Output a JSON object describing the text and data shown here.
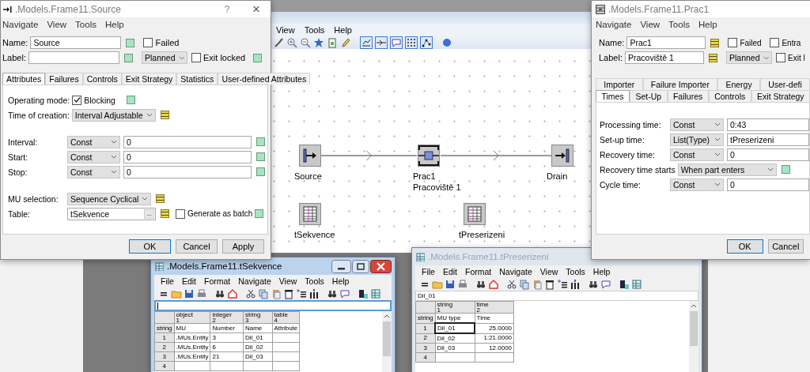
{
  "app_window": {
    "menu": [
      "View",
      "Tools",
      "Help"
    ],
    "nodes": [
      {
        "kind": "source",
        "label": "Source"
      },
      {
        "kind": "station",
        "label": "Prac1",
        "sublabel": "Pracoviště 1"
      },
      {
        "kind": "drain",
        "label": "Drain"
      },
      {
        "kind": "table",
        "label": "tSekvence"
      },
      {
        "kind": "table",
        "label": "tPreserizeni"
      }
    ]
  },
  "source_dialog": {
    "title": ".Models.Frame11.Source",
    "help": "?",
    "close": "×",
    "menu": [
      "Navigate",
      "View",
      "Tools",
      "Help"
    ],
    "header_rows": [
      {
        "label": "Name:",
        "value": "Source",
        "inherited": true,
        "extras": [
          {
            "kind": "checkbox",
            "label": "Failed",
            "checked": false
          }
        ]
      },
      {
        "label": "Label:",
        "inherited": true,
        "extras": [
          {
            "kind": "select",
            "value": "Planned"
          },
          {
            "kind": "checkbox",
            "label": "Exit locked",
            "checked": false
          },
          {
            "kind": "indicator",
            "inherited": true
          }
        ]
      }
    ],
    "tab_rows": [
      [
        {
          "label": "Attributes",
          "selected": true
        },
        {
          "label": "Failures",
          "selected": false
        },
        {
          "label": "Controls",
          "selected": false
        },
        {
          "label": "Exit Strategy",
          "selected": false
        },
        {
          "label": "Statistics",
          "selected": false
        },
        {
          "label": "User-defined Attributes",
          "selected": false
        }
      ]
    ],
    "groups": [
      [
        {
          "kind": "checkbox",
          "label": "Operating mode:",
          "text": "Blocking",
          "checked": true,
          "inherited": true
        },
        {
          "kind": "select",
          "label": "Time of creation:",
          "value": "Interval Adjustable",
          "inherited": false
        }
      ],
      [
        {
          "kind": "distribution",
          "label": "Interval:",
          "type": "Const",
          "value": "0",
          "inherited": true
        },
        {
          "kind": "distribution",
          "label": "Start:",
          "type": "Const",
          "value": "0",
          "inherited": true
        },
        {
          "kind": "distribution",
          "label": "Stop:",
          "type": "Const",
          "value": "0",
          "inherited": true
        }
      ],
      [
        {
          "kind": "select",
          "label": "MU selection:",
          "value": "Sequence Cyclical",
          "inherited": false
        },
        {
          "kind": "table",
          "label": "Table:",
          "value": "tSekvence",
          "browse": "...",
          "inherited": false,
          "extra": {
            "label": "Generate as batch",
            "checked": false,
            "inherited": true
          }
        }
      ]
    ],
    "buttons": [
      {
        "label": "OK",
        "default": true
      },
      {
        "label": "Cancel",
        "default": false
      },
      {
        "label": "Apply",
        "default": false
      }
    ]
  },
  "station_dialog": {
    "title": ".Models.Frame11.Prac1",
    "menu": [
      "Navigate",
      "View",
      "Tools",
      "Help"
    ],
    "header_rows": [
      {
        "label": "Name:",
        "value": "Prac1",
        "inherited": false,
        "extras": [
          {
            "kind": "checkbox",
            "label": "Failed",
            "checked": false
          },
          {
            "kind": "checkbox",
            "label": "Entra",
            "checked": false
          }
        ]
      },
      {
        "label": "Label:",
        "value": "Pracoviště 1",
        "inherited": false,
        "extras": [
          {
            "kind": "select",
            "value": "Planned"
          },
          {
            "kind": "checkbox",
            "label": "Exit l",
            "checked": false
          }
        ]
      }
    ],
    "tab_rows": [
      [
        {
          "label": "Importer",
          "selected": false
        },
        {
          "label": "Failure Importer",
          "selected": false
        },
        {
          "label": "Energy",
          "selected": false
        },
        {
          "label": "User-defi",
          "selected": false
        }
      ],
      [
        {
          "label": "Times",
          "selected": true
        },
        {
          "label": "Set-Up",
          "selected": false
        },
        {
          "label": "Failures",
          "selected": false
        },
        {
          "label": "Controls",
          "selected": false
        },
        {
          "label": "Exit Strategy",
          "selected": false
        }
      ]
    ],
    "groups": [
      [
        {
          "kind": "distribution",
          "label": "Processing time:",
          "type": "Const",
          "value": "0:43"
        },
        {
          "kind": "distribution",
          "label": "Set-up time:",
          "type": "List(Type)",
          "value": "tPreserizeni"
        },
        {
          "kind": "distribution",
          "label": "Recovery time:",
          "type": "Const",
          "value": "0"
        },
        {
          "kind": "select",
          "label": "Recovery time starts",
          "value": "When part enters",
          "inherited": true
        },
        {
          "kind": "distribution",
          "label": "Cycle time:",
          "type": "Const",
          "value": "0"
        }
      ]
    ],
    "buttons": [
      {
        "label": "OK",
        "default": true
      },
      {
        "label": "Cancel",
        "default": false
      }
    ]
  },
  "table_windows": [
    {
      "title": ".Models.Frame11.tSekvence",
      "active": true,
      "focused": true,
      "menu": [
        "File",
        "Edit",
        "Format",
        "Navigate",
        "View",
        "Tools",
        "Help"
      ],
      "row_type": "string",
      "columns": [
        {
          "type": "object",
          "index": "1",
          "name": "MU"
        },
        {
          "type": "integer",
          "index": "2",
          "name": "Number"
        },
        {
          "type": "string",
          "index": "3",
          "name": "Name"
        },
        {
          "type": "table",
          "index": "4",
          "name": "Attribute"
        }
      ],
      "rows": [
        {
          "header": "1",
          "cells": [
            {
              "text": ".MUs.Entity",
              "selected": false
            },
            {
              "text": "3",
              "selected": false
            },
            {
              "text": "Dil_01",
              "selected": false
            }
          ]
        },
        {
          "header": "2",
          "cells": [
            {
              "text": ".MUs.Entity",
              "selected": false
            },
            {
              "text": "6",
              "selected": false
            },
            {
              "text": "Dil_02",
              "selected": false
            }
          ]
        },
        {
          "header": "3",
          "cells": [
            {
              "text": ".MUs.Entity",
              "selected": false
            },
            {
              "text": "21",
              "selected": false
            },
            {
              "text": "Dil_03",
              "selected": false
            }
          ]
        },
        {
          "header": "4",
          "cells": []
        }
      ]
    },
    {
      "title": ".Models.Frame11.tPreserizeni",
      "active": false,
      "focused": false,
      "menu": [
        "File",
        "Edit",
        "Format",
        "Navigate",
        "View",
        "Tools",
        "Help"
      ],
      "edit_value": "Dil_01",
      "row_type": "string",
      "columns": [
        {
          "type": "string",
          "index": "1",
          "name": "MU type",
          "kind": "text"
        },
        {
          "type": "time",
          "index": "2",
          "name": "Time",
          "kind": "number"
        }
      ],
      "rows": [
        {
          "header": "1",
          "cells": [
            {
              "text": "Dil_01",
              "selected": true
            },
            {
              "text": "25.0000",
              "selected": false
            }
          ]
        },
        {
          "header": "2",
          "cells": [
            {
              "text": "Dil_02",
              "selected": false
            },
            {
              "text": "1:21.0000",
              "selected": false
            }
          ]
        },
        {
          "header": "3",
          "cells": [
            {
              "text": "Dil_03",
              "selected": false
            },
            {
              "text": "12.0000",
              "selected": false
            }
          ]
        },
        {
          "header": "4",
          "cells": []
        }
      ]
    }
  ]
}
